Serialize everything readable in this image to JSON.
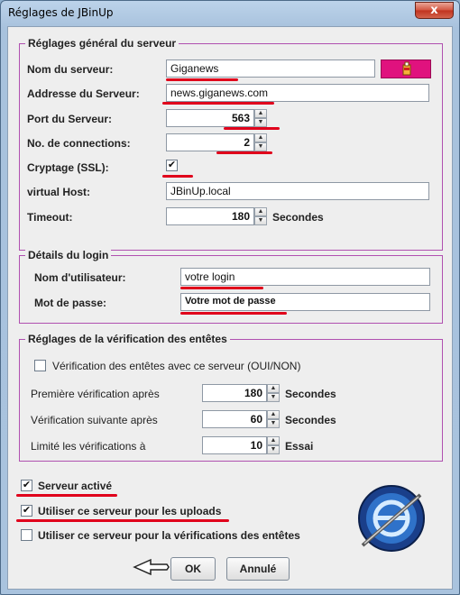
{
  "window": {
    "title": "Réglages de JBinUp",
    "close_glyph": "x"
  },
  "server_group": {
    "legend": "Réglages général du serveur",
    "name_label": "Nom du serveur:",
    "name_value": "Giganews",
    "address_label": "Addresse du Serveur:",
    "address_value": "news.giganews.com",
    "port_label": "Port du Serveur:",
    "port_value": "563",
    "connections_label": "No. de connections:",
    "connections_value": "2",
    "ssl_label": "Cryptage (SSL):",
    "ssl_checked": true,
    "vhost_label": "virtual Host:",
    "vhost_value": "JBinUp.local",
    "timeout_label": "Timeout:",
    "timeout_value": "180",
    "timeout_unit": "Secondes"
  },
  "login_group": {
    "legend": "Détails du login",
    "user_label": "Nom d'utilisateur:",
    "user_value": "votre login",
    "pass_label": "Mot de passe:",
    "pass_value": "Votre mot de passe"
  },
  "header_check_group": {
    "legend": "Réglages de la vérification des entêtes",
    "enable_label": "Vérification des entêtes avec ce serveur (OUI/NON)",
    "first_label": "Première vérification après",
    "first_value": "180",
    "first_unit": "Secondes",
    "next_label": "Vérification suivante après",
    "next_value": "60",
    "next_unit": "Secondes",
    "limit_label": "Limité les vérifications à",
    "limit_value": "10",
    "limit_unit": "Essai"
  },
  "options": {
    "active_label": "Serveur activé",
    "uploads_label": "Utiliser ce serveur pour les uploads",
    "verify_label": "Utiliser ce serveur pour la vérifications des entêtes"
  },
  "buttons": {
    "ok": "OK",
    "cancel": "Annulé"
  },
  "colors": {
    "highlight": "#e0001b",
    "group_border": "#b050b0",
    "color_button": "#e0127e"
  },
  "icons": [
    "close-icon",
    "paint-bucket-icon",
    "spinner-up-icon",
    "spinner-down-icon",
    "checkmark-icon",
    "pointer-hand-icon",
    "jbinup-logo-icon"
  ]
}
